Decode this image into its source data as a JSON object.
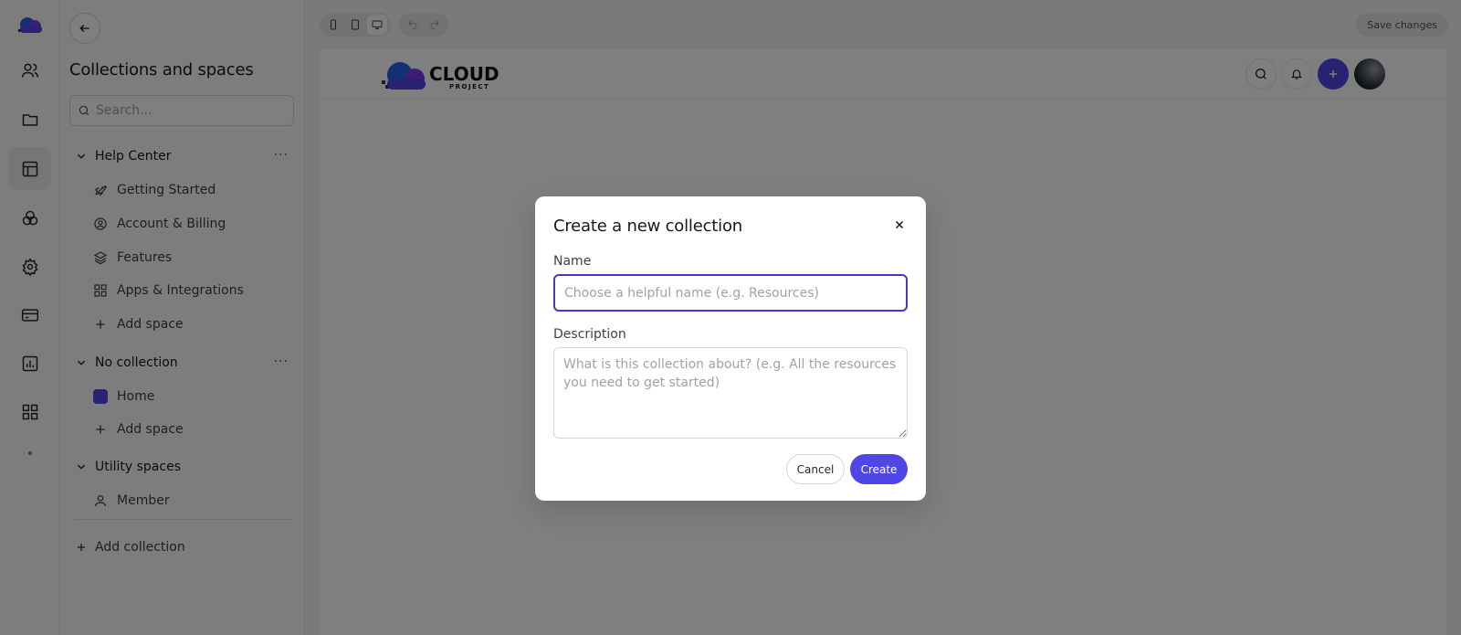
{
  "sidebar": {
    "title": "Collections and spaces",
    "search_placeholder": "Search...",
    "groups": [
      {
        "label": "Help Center",
        "items": [
          {
            "label": "Getting Started",
            "icon": "rocket-icon"
          },
          {
            "label": "Account & Billing",
            "icon": "user-circle-icon"
          },
          {
            "label": "Features",
            "icon": "layers-icon"
          },
          {
            "label": "Apps & Integrations",
            "icon": "grid-icon"
          },
          {
            "label": "Add space",
            "icon": "plus-icon"
          }
        ]
      },
      {
        "label": "No collection",
        "items": [
          {
            "label": "Home",
            "icon": "color-square-icon"
          },
          {
            "label": "Add space",
            "icon": "plus-icon"
          }
        ]
      },
      {
        "label": "Utility spaces",
        "items": [
          {
            "label": "Member",
            "icon": "person-icon"
          }
        ]
      }
    ],
    "add_collection": "Add collection"
  },
  "rail": {
    "icons": [
      "users-icon",
      "folder-icon",
      "layout-icon",
      "circles-icon",
      "gear-icon",
      "credit-card-icon",
      "chart-icon",
      "apps-icon"
    ],
    "active": "layout-icon"
  },
  "toolbar": {
    "save_label": "Save changes"
  },
  "brand": {
    "name": "CLOUD",
    "sub": "PROJECT",
    "accent": "#4f46e5"
  },
  "modal": {
    "title": "Create a new collection",
    "name_label": "Name",
    "name_placeholder": "Choose a helpful name (e.g. Resources)",
    "description_label": "Description",
    "description_placeholder": "What is this collection about? (e.g. All the resources you need to get started)",
    "cancel_label": "Cancel",
    "create_label": "Create"
  }
}
